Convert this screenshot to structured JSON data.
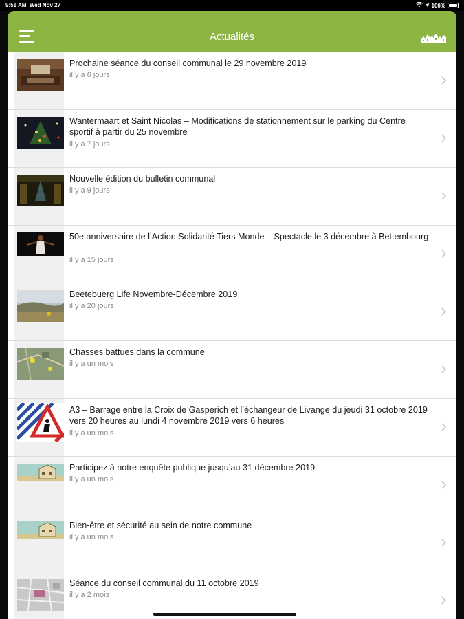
{
  "status": {
    "time": "9:51 AM",
    "date": "Wed Nov 27",
    "battery": "100%"
  },
  "nav": {
    "title": "Actualités",
    "menu_icon": "hamburger-menu-icon",
    "logo_icon": "town-skyline-logo-icon"
  },
  "colors": {
    "accent": "#8db544",
    "text": "#1e1e1e",
    "meta": "#8a8a8a"
  },
  "news": [
    {
      "title": "Prochaine séance du conseil communal le 29 novembre 2019",
      "time": "il y a 6 jours"
    },
    {
      "title": "Wantermaart et Saint Nicolas – Modifications de stationnement sur le parking du Centre sportif à partir du 25 novembre",
      "time": "il y a 7 jours"
    },
    {
      "title": "Nouvelle édition du bulletin communal",
      "time": "il y a 9 jours"
    },
    {
      "title": "50e anniversaire de l’Action Solidarité Tiers Monde – Spectacle le 3 décembre à Bettembourg",
      "time": "il y a 15 jours"
    },
    {
      "title": "Beetebuerg Life Novembre-Décembre 2019",
      "time": "il y a 20 jours"
    },
    {
      "title": "Chasses battues dans la commune",
      "time": "il y a un mois"
    },
    {
      "title": "A3 – Barrage entre la Croix de Gasperich et l’échangeur de Livange du jeudi 31 octobre 2019 vers 20 heures au lundi 4 novembre 2019 vers 6 heures",
      "time": "il y a un mois"
    },
    {
      "title": "Participez à notre enquête publique jusqu’au 31 décembre 2019",
      "time": "il y a un mois"
    },
    {
      "title": "Bien-être et sécurité au sein de notre commune",
      "time": "il y a un mois"
    },
    {
      "title": "Séance du conseil communal du 11 octobre 2019",
      "time": "il y a 2 mois"
    }
  ]
}
